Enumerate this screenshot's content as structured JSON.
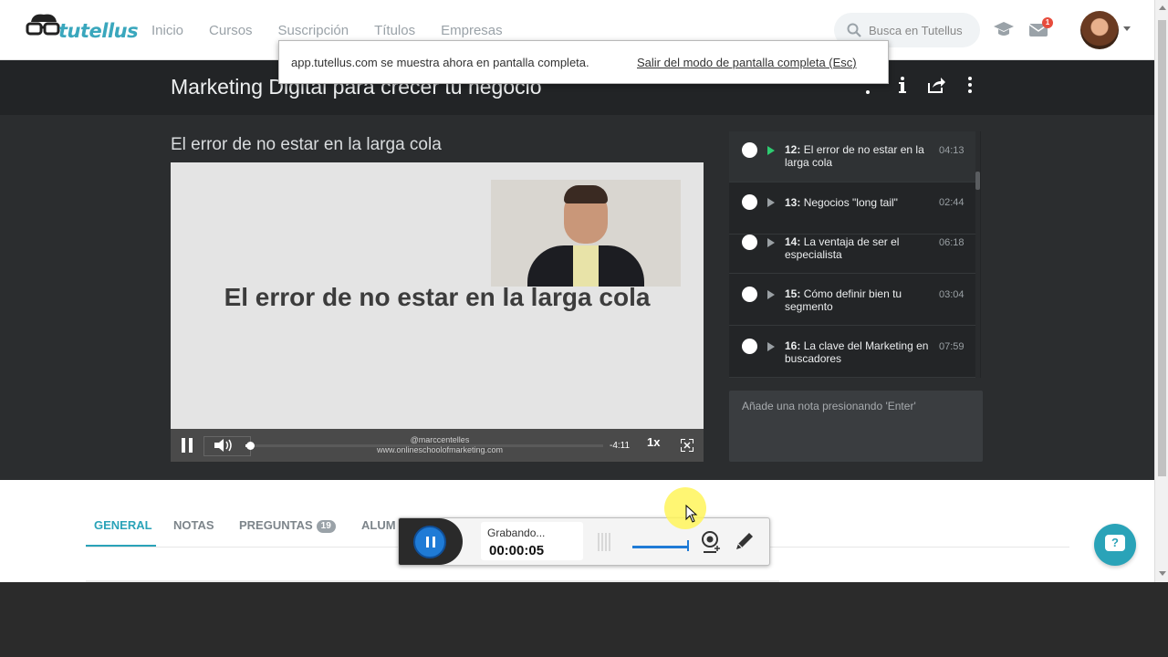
{
  "nav": {
    "brand": "tutellus",
    "links": [
      "Inicio",
      "Cursos",
      "Suscripción",
      "Títulos",
      "Empresas"
    ],
    "search_placeholder": "Busca en Tutellus",
    "messages_count": "1"
  },
  "fullscreen_notice": {
    "message": "app.tutellus.com se muestra ahora en pantalla completa.",
    "exit_link": "Salir del modo de pantalla completa (Esc)"
  },
  "course": {
    "title": "Marketing Digital para crecer tu negocio"
  },
  "lesson": {
    "title": "El error de no estar en la larga cola"
  },
  "video": {
    "slide_text": "El error de no estar en la larga cola",
    "watermark_line1": "@marccentelles",
    "watermark_line2": "www.onlineschoolofmarketing.com",
    "remaining_time": "-4:11",
    "speed": "1x",
    "progress": 0.01
  },
  "lessons": [
    {
      "number": "12:",
      "title": "El error de no estar en la larga cola",
      "duration": "04:13",
      "active": true
    },
    {
      "number": "13:",
      "title": "Negocios \"long tail\"",
      "duration": "02:44",
      "active": false
    },
    {
      "number": "14:",
      "title": "La ventaja de ser el especialista",
      "duration": "06:18",
      "active": false
    },
    {
      "number": "15:",
      "title": "Cómo definir bien tu segmento",
      "duration": "03:04",
      "active": false
    },
    {
      "number": "16:",
      "title": "La clave del Marketing en buscadores",
      "duration": "07:59",
      "active": false
    }
  ],
  "note": {
    "placeholder": "Añade una nota presionando 'Enter'"
  },
  "tabs": [
    {
      "label": "GENERAL",
      "active": true
    },
    {
      "label": "NOTAS",
      "active": false
    },
    {
      "label": "PREGUNTAS",
      "badge": "19",
      "active": false
    },
    {
      "label": "ALUM",
      "active": false
    }
  ],
  "recorder": {
    "status": "Grabando...",
    "elapsed": "00:00:05"
  },
  "colors": {
    "accent": "#2aa3b8",
    "active_lesson_play": "#2ecc71",
    "recorder_blue": "#1f7bd6"
  }
}
